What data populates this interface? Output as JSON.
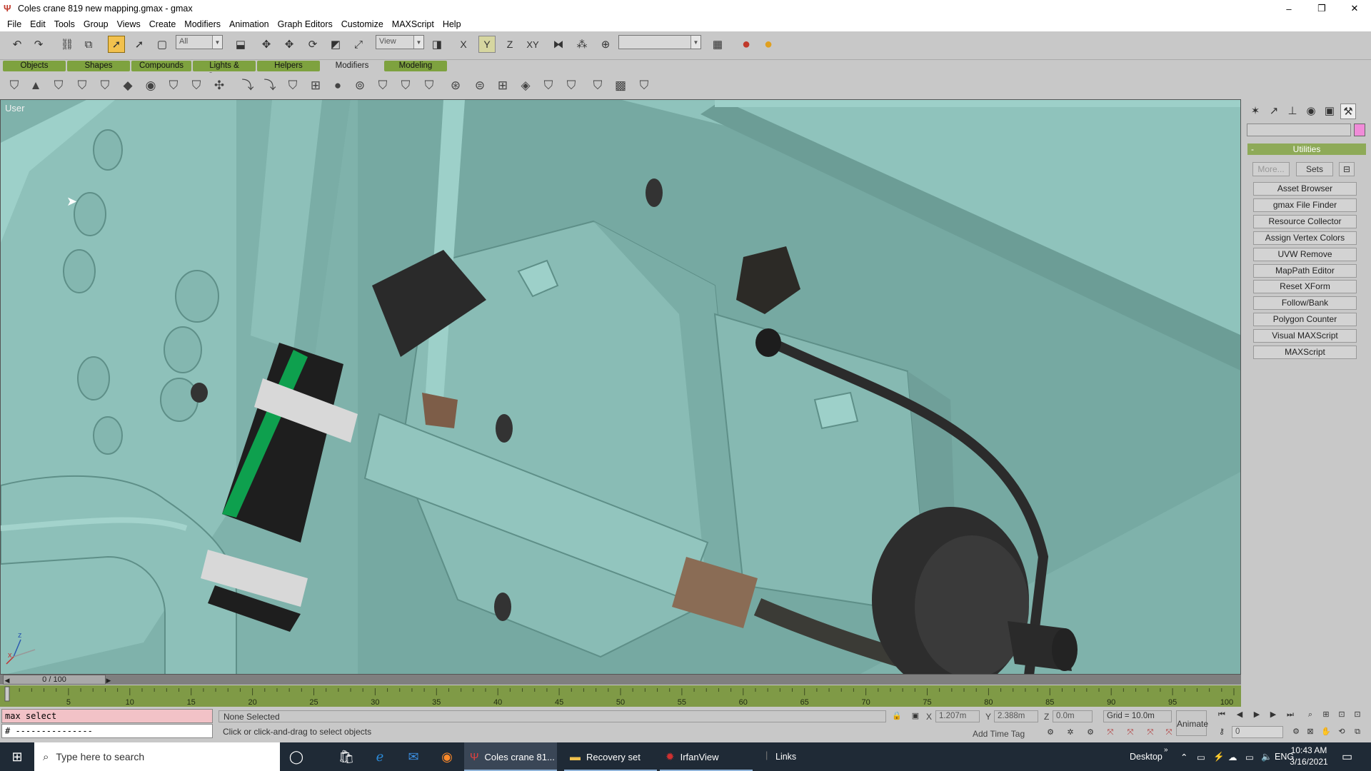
{
  "window": {
    "title": "Coles crane 819 new mapping.gmax - gmax",
    "minimize": "–",
    "maximize": "❐",
    "close": "✕"
  },
  "menu": [
    "File",
    "Edit",
    "Tools",
    "Group",
    "Views",
    "Create",
    "Modifiers",
    "Animation",
    "Graph Editors",
    "Customize",
    "MAXScript",
    "Help"
  ],
  "toolbar": {
    "selection_filter": "All",
    "reference_coord": "View",
    "constraint_labels": [
      "X",
      "Y",
      "Z",
      "XY"
    ],
    "named_selection": ""
  },
  "tabs": [
    "Objects",
    "Shapes",
    "Compounds",
    "Lights & Cameras",
    "Helpers",
    "Modifiers",
    "Modeling"
  ],
  "active_tab": "Modifiers",
  "viewport": {
    "label": "User",
    "axis_labels": [
      "z",
      "x"
    ]
  },
  "command_panel": {
    "rollout_title": "Utilities",
    "more_label": "More...",
    "sets_label": "Sets",
    "utilities": [
      "Asset Browser",
      "gmax File Finder",
      "Resource Collector",
      "Assign Vertex Colors",
      "UVW Remove",
      "MapPath Editor",
      "Reset XForm",
      "Follow/Bank",
      "Polygon Counter",
      "Visual MAXScript",
      "MAXScript"
    ],
    "object_color": "#f08bd8"
  },
  "time": {
    "slider_label": "0 / 100",
    "ticks": [
      "5",
      "10",
      "15",
      "20",
      "25",
      "30",
      "35",
      "40",
      "45",
      "50",
      "55",
      "60",
      "65",
      "70",
      "75",
      "80",
      "85",
      "90",
      "95",
      "100"
    ]
  },
  "status": {
    "listener_line1": "max select",
    "listener_line2": "# ---------------",
    "selection_info": "None Selected",
    "prompt": "Click or click-and-drag to select objects",
    "x_label": "X",
    "x_value": "1.207m",
    "y_label": "Y",
    "y_value": "2.388m",
    "z_label": "Z",
    "z_value": "0.0m",
    "grid": "Grid = 10.0m",
    "add_time_tag": "Add Time Tag",
    "animate": "Animate",
    "current_frame": "0"
  },
  "taskbar": {
    "search_placeholder": "Type here to search",
    "apps": [
      {
        "label": "Coles crane 81...",
        "active": true
      },
      {
        "label": "Recovery set",
        "active": false
      },
      {
        "label": "IrfanView",
        "active": false
      }
    ],
    "links": "Links",
    "desktop": "Desktop",
    "language": "ENG",
    "time": "10:43 AM",
    "date": "3/16/2021"
  },
  "colors": {
    "model_teal": "#7fb2ab",
    "trackbar_green": "#7f9a46",
    "tab_green": "#7ea23f",
    "selected_tool": "#f2c14e"
  }
}
